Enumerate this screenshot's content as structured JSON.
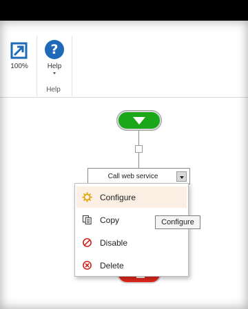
{
  "ribbon": {
    "zoom_button": {
      "label": "100%",
      "icon": "zoom-reset-icon"
    },
    "help_button": {
      "label": "Help",
      "icon": "help-icon"
    },
    "group_label": "Help"
  },
  "workflow": {
    "start_node": {
      "icon": "start-arrow-icon",
      "color": "#1aa71a"
    },
    "step": {
      "title": "Call web service"
    },
    "end_node": {
      "color": "#e0281e"
    }
  },
  "context_menu": {
    "items": [
      {
        "label": "Configure",
        "icon": "gear-icon",
        "highlighted": true
      },
      {
        "label": "Copy",
        "icon": "copy-icon",
        "highlighted": false
      },
      {
        "label": "Disable",
        "icon": "disable-icon",
        "highlighted": false
      },
      {
        "label": "Delete",
        "icon": "delete-icon",
        "highlighted": false
      }
    ]
  },
  "tooltip": {
    "text": "Configure"
  },
  "colors": {
    "accent_blue": "#1e69b8",
    "menu_highlight": "#fbeee3",
    "danger_red": "#e0281e"
  }
}
